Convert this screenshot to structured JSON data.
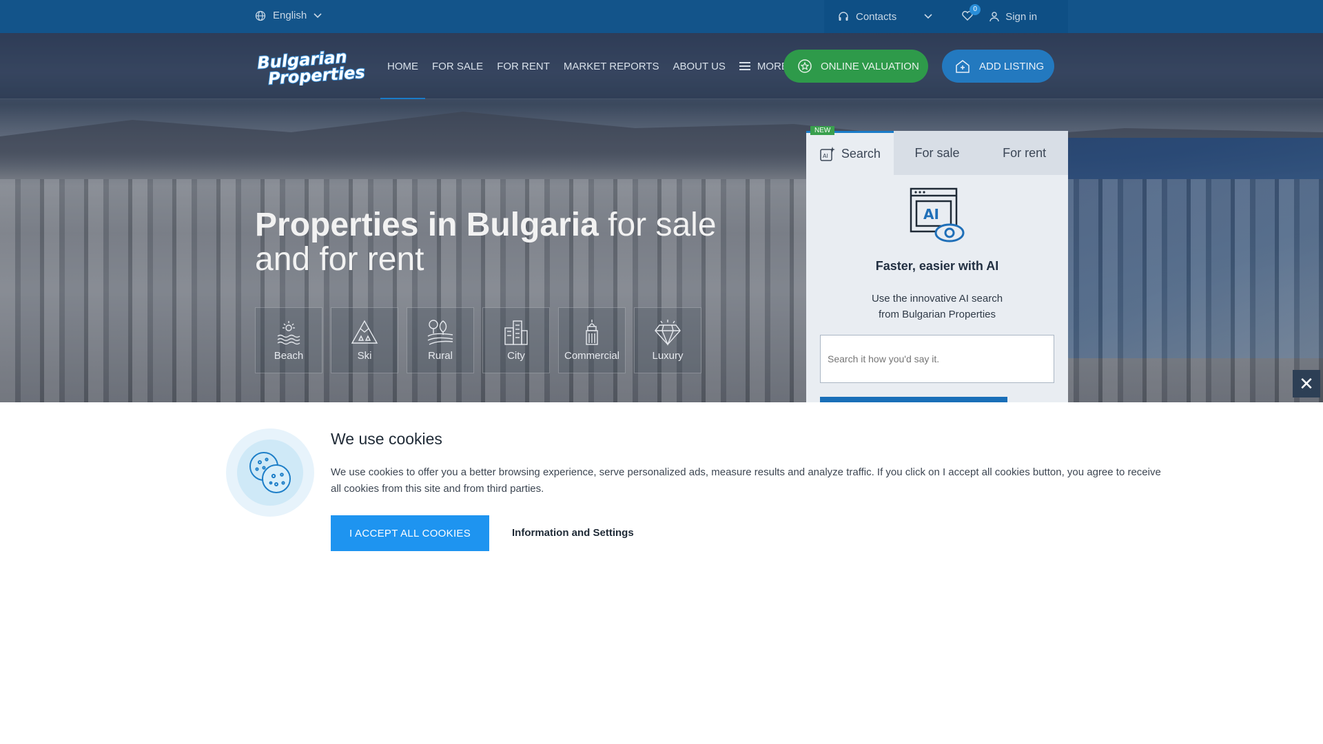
{
  "topbar": {
    "language": "English",
    "contacts": "Contacts",
    "favorites_count": "0",
    "sign_in": "Sign in"
  },
  "brand": {
    "logo_line1": "Bulgarian",
    "logo_line2": "Properties"
  },
  "nav": {
    "items": [
      "HOME",
      "FOR SALE",
      "FOR RENT",
      "MARKET REPORTS",
      "ABOUT US",
      "MORE"
    ],
    "active": "HOME",
    "online_valuation": "ONLINE VALUATION",
    "add_listing": "ADD LISTING"
  },
  "hero": {
    "title_bold": "Properties in Bulgaria",
    "title_light": " for sale and for rent",
    "categories": [
      {
        "label": "Beach",
        "icon": "beach-icon"
      },
      {
        "label": "Ski",
        "icon": "ski-icon"
      },
      {
        "label": "Rural",
        "icon": "rural-icon"
      },
      {
        "label": "City",
        "icon": "city-icon"
      },
      {
        "label": "Commercial",
        "icon": "commercial-icon"
      },
      {
        "label": "Luxury",
        "icon": "luxury-icon"
      }
    ]
  },
  "search_panel": {
    "new_tag": "NEW",
    "tabs": [
      "Search",
      "For sale",
      "For rent"
    ],
    "active_tab": "Search",
    "heading": "Faster, easier with AI",
    "description": "Use the innovative AI search from Bulgarian Properties",
    "input_placeholder": "Search it how you'd say it."
  },
  "cookie_banner": {
    "title": "We use cookies",
    "text": "We use cookies to offer you a better browsing experience, serve personalized ads, measure results and analyze traffic. If you click on I accept all cookies button, you agree to receive all cookies from this site and from third parties.",
    "accept_label": "I ACCEPT ALL COOKIES",
    "settings_label": "Information and Settings",
    "close_symbol": "✕"
  },
  "colors": {
    "topbar": "#10568e",
    "accent": "#1e94f0",
    "valuation": "#2e9a4a",
    "add_listing": "#2379bf"
  }
}
